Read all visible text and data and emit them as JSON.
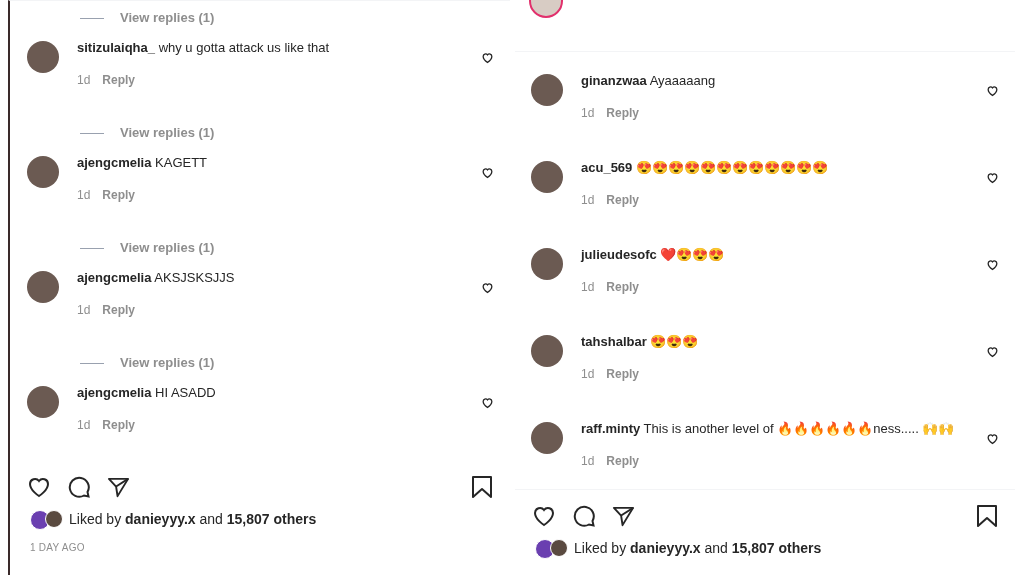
{
  "panels": [
    {
      "items": [
        {
          "kind": "view_replies",
          "label": "View replies (1)"
        },
        {
          "kind": "comment",
          "username": "sitizulaiqha_",
          "text": "why u gotta attack us like that",
          "time": "1d",
          "reply": "Reply"
        },
        {
          "kind": "view_replies",
          "label": "View replies (1)"
        },
        {
          "kind": "comment",
          "username": "ajengcmelia",
          "text": "KAGETT",
          "time": "1d",
          "reply": "Reply"
        },
        {
          "kind": "view_replies",
          "label": "View replies (1)"
        },
        {
          "kind": "comment",
          "username": "ajengcmelia",
          "text": "AKSJSKSJJS",
          "time": "1d",
          "reply": "Reply"
        },
        {
          "kind": "view_replies",
          "label": "View replies (1)"
        },
        {
          "kind": "comment",
          "username": "ajengcmelia",
          "text": "HI ASADD",
          "time": "1d",
          "reply": "Reply"
        }
      ],
      "likes": "Liked by **danieyyy.x** and **15,807 others**",
      "date": "1 DAY AGO"
    },
    {
      "items": [
        {
          "kind": "header"
        },
        {
          "kind": "comment",
          "username": "ginanzwaa",
          "text": "Ayaaaaang",
          "time": "1d",
          "reply": "Reply"
        },
        {
          "kind": "comment",
          "username": "acu_569",
          "text": "😍😍😍😍😍😍😍😍😍😍😍😍",
          "time": "1d",
          "reply": "Reply"
        },
        {
          "kind": "comment",
          "username": "julieudesofc",
          "text": "❤️😍😍😍",
          "time": "1d",
          "reply": "Reply"
        },
        {
          "kind": "comment",
          "username": "tahshalbar",
          "text": "😍😍😍",
          "time": "1d",
          "reply": "Reply"
        },
        {
          "kind": "comment",
          "username": "raff.minty",
          "text": "This is another level of 🔥🔥🔥🔥🔥🔥ness..... 🙌🙌",
          "time": "1d",
          "reply": "Reply"
        }
      ],
      "likes": "Liked by **danieyyy.x** and **15,807 others**"
    }
  ]
}
